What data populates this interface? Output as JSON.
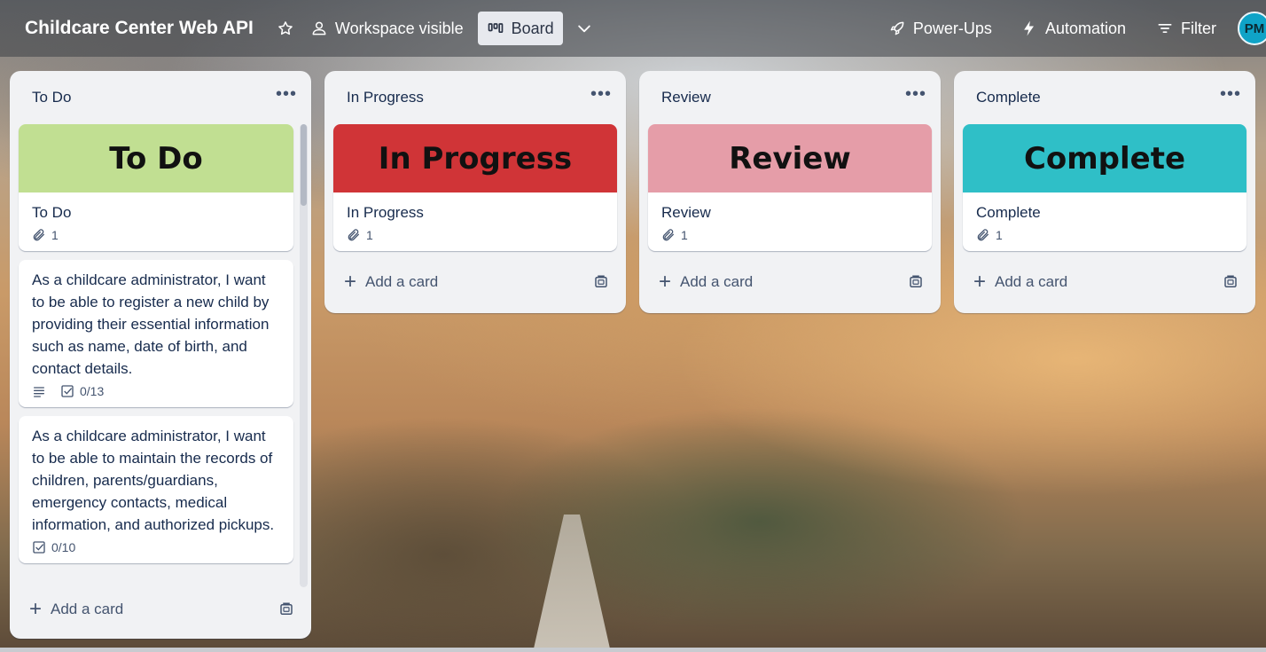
{
  "header": {
    "board_title": "Childcare Center Web API",
    "star_icon": "star-icon",
    "visibility_label": "Workspace visible",
    "view_label": "Board",
    "powerups_label": "Power-Ups",
    "automation_label": "Automation",
    "filter_label": "Filter",
    "avatar_initials": "PM"
  },
  "lists": [
    {
      "title": "To Do",
      "cards": [
        {
          "cover_text": "To Do",
          "cover_color": "#c1df92",
          "title": "To Do",
          "attachments": "1"
        },
        {
          "title": "As a childcare administrator, I want to be able to register a new child by providing their essential information such as name, date of birth, and contact details.",
          "has_description": true,
          "checklist": "0/13"
        },
        {
          "title": "As a childcare administrator, I want to be able to maintain the records of children, parents/guardians, emergency contacts, medical information, and authorized pickups.",
          "checklist": "0/10"
        }
      ],
      "add_card": "Add a card"
    },
    {
      "title": "In Progress",
      "cards": [
        {
          "cover_text": "In Progress",
          "cover_color": "#d03437",
          "title": "In Progress",
          "attachments": "1"
        }
      ],
      "add_card": "Add a card"
    },
    {
      "title": "Review",
      "cards": [
        {
          "cover_text": "Review",
          "cover_color": "#e59da8",
          "title": "Review",
          "attachments": "1"
        }
      ],
      "add_card": "Add a card"
    },
    {
      "title": "Complete",
      "cards": [
        {
          "cover_text": "Complete",
          "cover_color": "#2fbfc7",
          "title": "Complete",
          "attachments": "1"
        }
      ],
      "add_card": "Add a card"
    }
  ]
}
